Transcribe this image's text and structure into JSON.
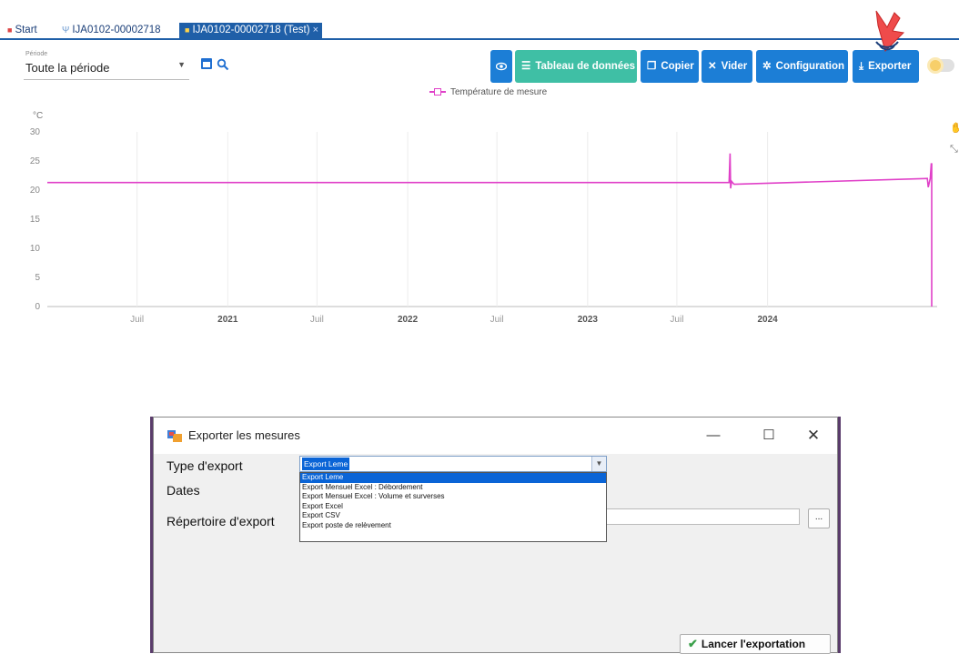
{
  "tabs": {
    "start": "Start",
    "tab1": "IJA0102-00002718",
    "tab2": "IJA0102-00002718 (Test)",
    "close": "×"
  },
  "period": {
    "label": "Période",
    "value": "Toute la période"
  },
  "toolbar": {
    "table_label": "Tableau de données",
    "copy_label": "Copier",
    "clear_label": "Vider",
    "config_label": "Configuration",
    "export_label": "Exporter"
  },
  "colors": {
    "primary": "#1c7ed6",
    "teal": "#3fbfa5",
    "series": "#e040c8",
    "tab_active": "#1f5fa8"
  },
  "chart_data": {
    "type": "line",
    "legend": [
      "Température de mesure"
    ],
    "legend_position": "top-center",
    "ylabel": "°C",
    "ylim": [
      0,
      30
    ],
    "yticks": [
      0,
      5,
      10,
      15,
      20,
      25,
      30
    ],
    "xticks": [
      "Juil",
      "2021",
      "Juil",
      "2022",
      "Juil",
      "2023",
      "Juil",
      "2024"
    ],
    "grid": "vertical",
    "series": [
      {
        "name": "Température de mesure",
        "x": [
          "2020-01",
          "2023-10-15",
          "2023-10-17",
          "2023-10-18",
          "2023-10-20",
          "2023-10-25",
          "2024-11-20",
          "2024-11-22",
          "2024-11-26",
          "2024-11-28",
          "2024-11-29",
          "2024-11-29"
        ],
        "values": [
          21.3,
          21.3,
          26.3,
          20.3,
          21.5,
          21.0,
          22.0,
          20.5,
          22.0,
          24.5,
          24.5,
          0
        ]
      }
    ]
  },
  "dialog": {
    "title": "Exporter les mesures",
    "type_label": "Type d'export",
    "dates_label": "Dates",
    "dir_label": "Répertoire d'export",
    "selected": "Export Leme",
    "options": [
      "Export Leme",
      "Export Mensuel Excel : Débordement",
      "Export Mensuel Excel : Volume et surverses",
      "Export Excel",
      "Export CSV",
      "Export poste de relèvement"
    ],
    "browse_label": "...",
    "launch_label": "Lancer l'exportation",
    "min": "—",
    "max": "☐",
    "close": "✕"
  }
}
